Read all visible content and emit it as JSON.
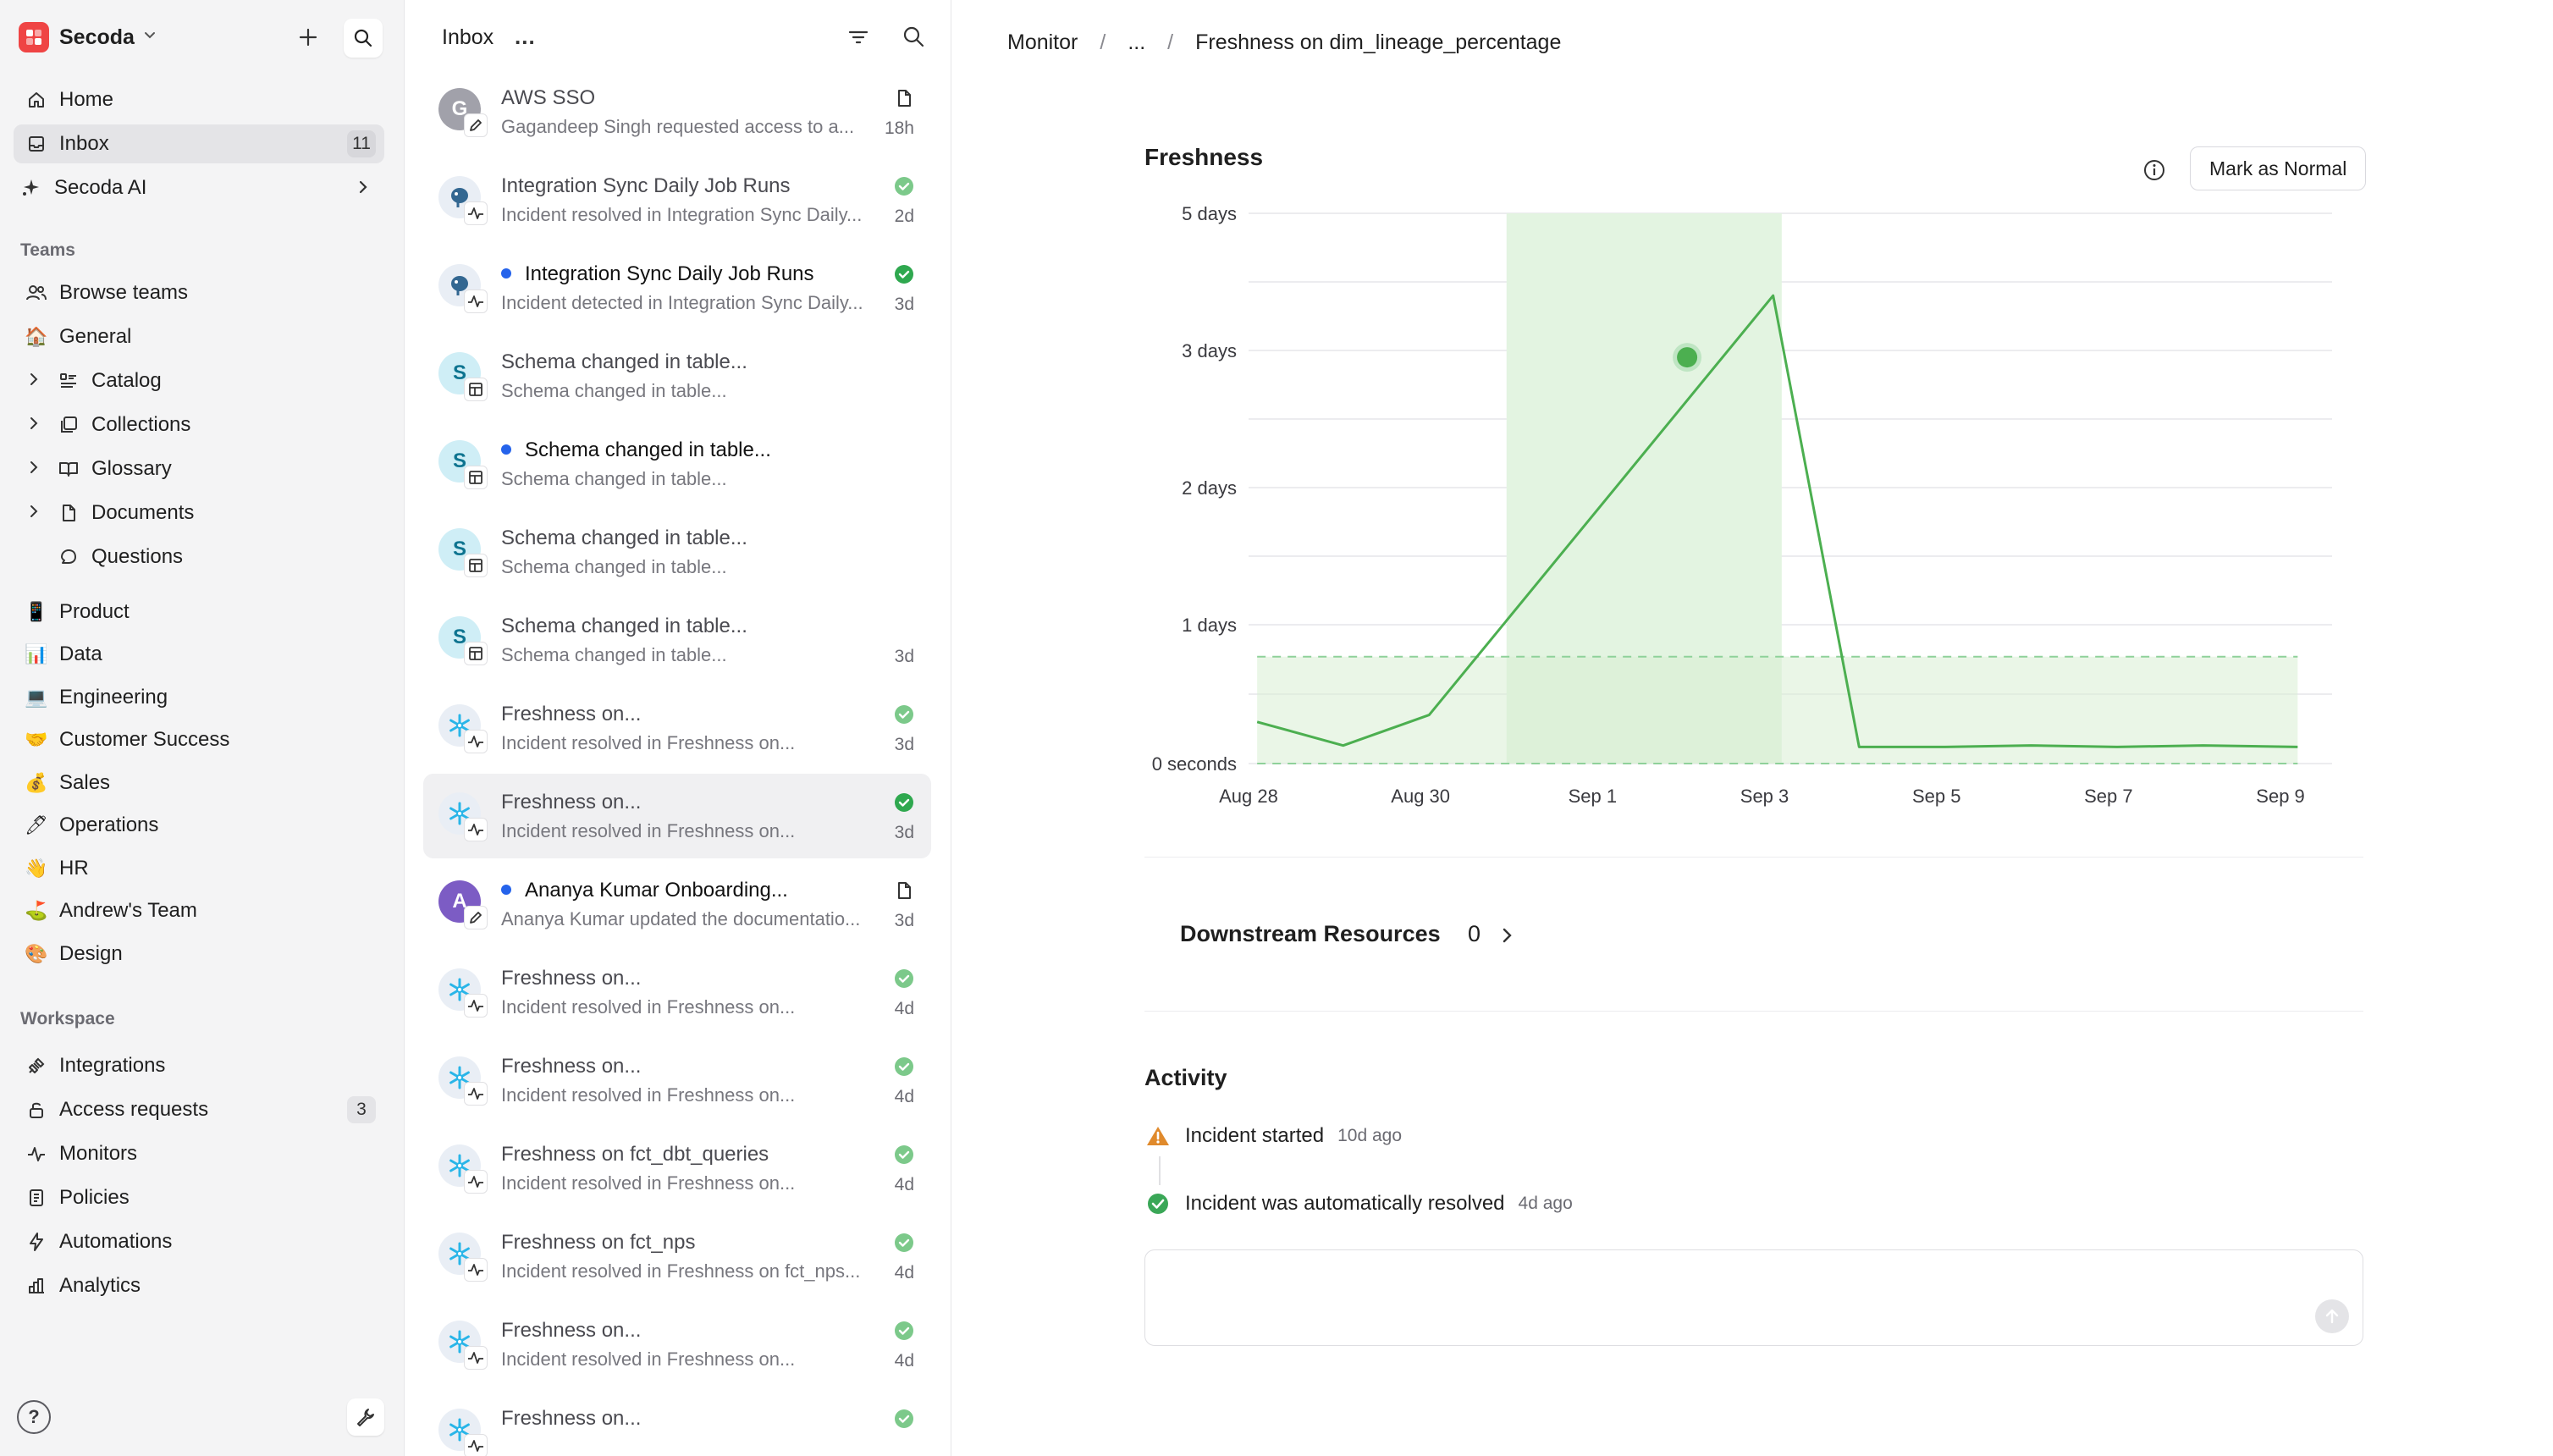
{
  "sidebar": {
    "workspace": "Secoda",
    "nav": [
      {
        "label": "Home",
        "icon": "home-icon"
      },
      {
        "label": "Inbox",
        "icon": "inbox-icon",
        "count": "11"
      },
      {
        "label": "Secoda AI",
        "icon": "sparkle-icon"
      }
    ],
    "teams_label": "Teams",
    "teams": [
      {
        "label": "Browse teams",
        "icon": "users-icon"
      },
      {
        "label": "General",
        "icon": "🏠"
      },
      {
        "label": "Catalog",
        "icon": "catalog-icon"
      },
      {
        "label": "Collections",
        "icon": "collections-icon"
      },
      {
        "label": "Glossary",
        "icon": "book-icon"
      },
      {
        "label": "Documents",
        "icon": "document-icon"
      },
      {
        "label": "Questions",
        "icon": "chat-icon"
      },
      {
        "label": "Product",
        "icon": "📱"
      },
      {
        "label": "Data",
        "icon": "📊"
      },
      {
        "label": "Engineering",
        "icon": "💻"
      },
      {
        "label": "Customer Success",
        "icon": "🤝"
      },
      {
        "label": "Sales",
        "icon": "💰"
      },
      {
        "label": "Operations",
        "icon": "🖊"
      },
      {
        "label": "HR",
        "icon": "👋"
      },
      {
        "label": "Andrew's Team",
        "icon": "⛳"
      },
      {
        "label": "Design",
        "icon": "🎨"
      }
    ],
    "workspace_label": "Workspace",
    "workspace_items": [
      {
        "label": "Integrations",
        "icon": "plug-icon"
      },
      {
        "label": "Access requests",
        "icon": "lock-icon",
        "count": "3"
      },
      {
        "label": "Monitors",
        "icon": "pulse-icon"
      },
      {
        "label": "Policies",
        "icon": "policy-icon"
      },
      {
        "label": "Automations",
        "icon": "bolt-icon"
      },
      {
        "label": "Analytics",
        "icon": "analytics-icon"
      }
    ],
    "help": "?"
  },
  "inbox": {
    "title": "Inbox",
    "more": "...",
    "items": [
      {
        "title": "AWS SSO",
        "subtitle": "Gagandeep Singh requested access to a...",
        "time": "18h",
        "avatar": "G",
        "unread": false,
        "status": "doc"
      },
      {
        "title": "Integration Sync Daily Job Runs",
        "subtitle": "Incident resolved in Integration Sync Daily...",
        "time": "2d",
        "avatar": "",
        "unread": false,
        "status": "check-light"
      },
      {
        "title": "Integration Sync Daily Job Runs",
        "subtitle": "Incident detected in Integration Sync Daily...",
        "time": "3d",
        "avatar": "",
        "unread": true,
        "status": "check"
      },
      {
        "title": "Schema changed in table...",
        "subtitle": "Schema changed in table...",
        "time": "",
        "avatar": "S",
        "unread": false,
        "status": ""
      },
      {
        "title": "Schema changed in table...",
        "subtitle": "Schema changed in table...",
        "time": "",
        "avatar": "S",
        "unread": true,
        "status": ""
      },
      {
        "title": "Schema changed in table...",
        "subtitle": "Schema changed in table...",
        "time": "",
        "avatar": "S",
        "unread": false,
        "status": ""
      },
      {
        "title": "Schema changed in table...",
        "subtitle": "Schema changed in table...",
        "time": "3d",
        "avatar": "S",
        "unread": false,
        "status": ""
      },
      {
        "title": "Freshness on...",
        "subtitle": "Incident resolved in Freshness on...",
        "time": "3d",
        "avatar": "",
        "unread": false,
        "status": "check-light"
      },
      {
        "title": "Freshness on...",
        "subtitle": "Incident resolved in Freshness on...",
        "time": "3d",
        "avatar": "",
        "unread": false,
        "status": "check"
      },
      {
        "title": "Ananya Kumar Onboarding...",
        "subtitle": "Ananya Kumar updated the documentatio...",
        "time": "3d",
        "avatar": "A",
        "unread": true,
        "status": "doc"
      },
      {
        "title": "Freshness on...",
        "subtitle": "Incident resolved in Freshness on...",
        "time": "4d",
        "avatar": "",
        "unread": false,
        "status": "check-light"
      },
      {
        "title": "Freshness on...",
        "subtitle": "Incident resolved in Freshness on...",
        "time": "4d",
        "avatar": "",
        "unread": false,
        "status": "check-light"
      },
      {
        "title": "Freshness on fct_dbt_queries",
        "subtitle": "Incident resolved in Freshness on...",
        "time": "4d",
        "avatar": "",
        "unread": false,
        "status": "check-light"
      },
      {
        "title": "Freshness on fct_nps",
        "subtitle": "Incident resolved in Freshness on fct_nps...",
        "time": "4d",
        "avatar": "",
        "unread": false,
        "status": "check-light"
      },
      {
        "title": "Freshness on...",
        "subtitle": "Incident resolved in Freshness on...",
        "time": "4d",
        "avatar": "",
        "unread": false,
        "status": "check-light"
      },
      {
        "title": "Freshness on...",
        "subtitle": "",
        "time": "",
        "avatar": "",
        "unread": false,
        "status": "check-light"
      }
    ]
  },
  "main": {
    "breadcrumb": [
      "Monitor",
      "...",
      "Freshness on dim_lineage_percentage"
    ],
    "freshness_title": "Freshness",
    "mark_button": "Mark as Normal",
    "downstream_label": "Downstream Resources",
    "downstream_count": "0",
    "activity_title": "Activity",
    "activity": [
      {
        "text": "Incident started",
        "ago": "10d ago",
        "icon": "warning-icon"
      },
      {
        "text": "Incident was automatically resolved",
        "ago": "4d ago",
        "icon": "check-circle-icon"
      }
    ]
  },
  "colors": {
    "accent_green": "#4caf50",
    "band_green": "#e3f4e1",
    "brand_red": "#ef4444",
    "unread_blue": "#2563eb"
  },
  "chart_data": {
    "type": "line",
    "title": "Freshness",
    "y_tick_labels": [
      "0 seconds",
      "1 days",
      "2 days",
      "3 days",
      "5 days"
    ],
    "y_ticks_days": [
      0,
      1,
      2,
      3,
      5
    ],
    "x_tick_labels": [
      "Aug 28",
      "Aug 30",
      "Sep 1",
      "Sep 3",
      "Sep 5",
      "Sep 7",
      "Sep 9"
    ],
    "x_tick_days": [
      0,
      2,
      4,
      6,
      8,
      10,
      12
    ],
    "ylim_days": [
      0,
      5
    ],
    "series": [
      {
        "x_days": [
          0.1,
          1.1,
          2.1,
          6.1,
          7.1,
          8.1,
          9.1,
          10.1,
          11.1,
          12.2
        ],
        "y_days": [
          0.3,
          0.13,
          0.35,
          3.8,
          0.12,
          0.12,
          0.13,
          0.12,
          0.13,
          0.12
        ]
      }
    ],
    "highlight_point": {
      "x_days": 5.1,
      "y_days": 2.95
    },
    "incident_window_days": [
      3.0,
      6.2
    ],
    "expected_band_days": {
      "x": [
        0.1,
        12.2
      ],
      "y": [
        0,
        0.77
      ]
    },
    "grid": true
  }
}
